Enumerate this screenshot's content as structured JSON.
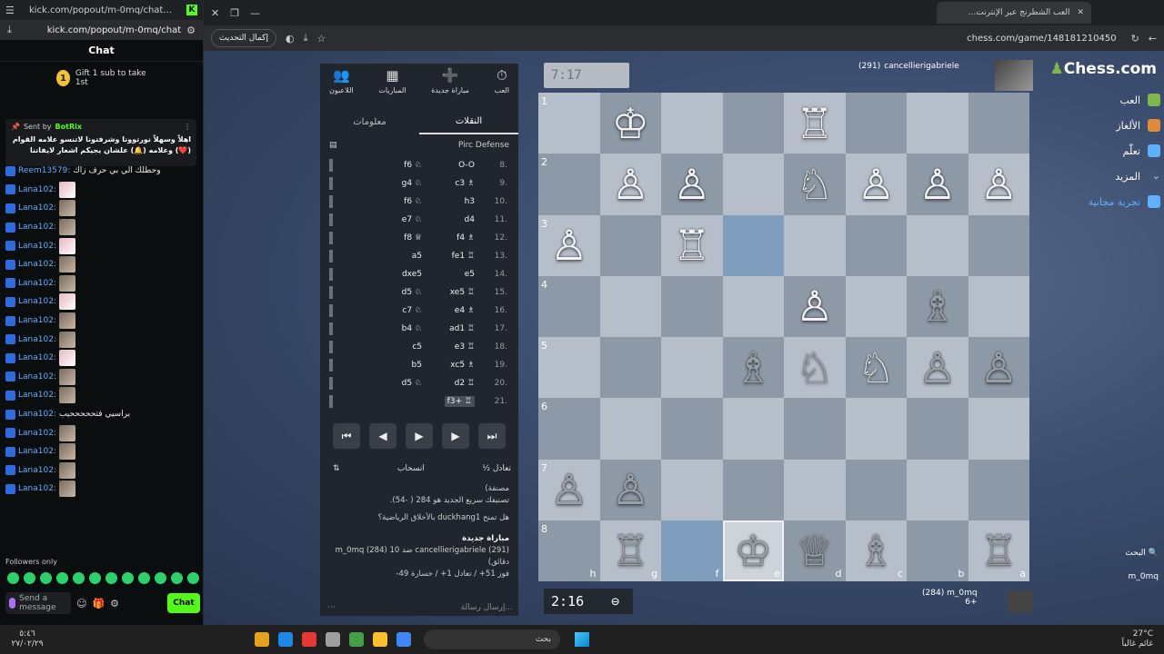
{
  "kick": {
    "title_url": "kick.com/popout/m-0mq/chat...",
    "url": "kick.com/popout/m-0mq/chat",
    "chat_title": "Chat",
    "gift_number": "1",
    "gift_text": "Gift 1 sub to take 1st",
    "pinned": {
      "sent_by": "Sent by",
      "bot_name": "BotRix",
      "message": "اهلاً وسهلاً نورتوونا وشرفتونا لاتنسو علامه القوام (❤️) وعلامه (🔔) علشان يجيكم اشعار لايفاتنا"
    },
    "messages": [
      {
        "user": "Reem13579:",
        "text": "وحطلك الي بي حرف زاك",
        "emote": ""
      },
      {
        "user": "Lana102:",
        "text": "",
        "emote": "pink"
      },
      {
        "user": "Lana102:",
        "text": "",
        "emote": "photo"
      },
      {
        "user": "Lana102:",
        "text": "",
        "emote": "photo"
      },
      {
        "user": "Lana102:",
        "text": "",
        "emote": "pink"
      },
      {
        "user": "Lana102:",
        "text": "",
        "emote": "photo"
      },
      {
        "user": "Lana102:",
        "text": "",
        "emote": "photo"
      },
      {
        "user": "Lana102:",
        "text": "",
        "emote": "pink"
      },
      {
        "user": "Lana102:",
        "text": "",
        "emote": "photo"
      },
      {
        "user": "Lana102:",
        "text": "",
        "emote": "photo"
      },
      {
        "user": "Lana102:",
        "text": "",
        "emote": "pink"
      },
      {
        "user": "Lana102:",
        "text": "",
        "emote": "photo"
      },
      {
        "user": "Lana102:",
        "text": "",
        "emote": "photo"
      },
      {
        "user": "Lana102:",
        "text": "براسيي فتحححححيب",
        "emote": ""
      },
      {
        "user": "Lana102:",
        "text": "",
        "emote": "photo"
      },
      {
        "user": "Lana102:",
        "text": "",
        "emote": "photo"
      },
      {
        "user": "Lana102:",
        "text": "",
        "emote": "photo"
      },
      {
        "user": "Lana102:",
        "text": "",
        "emote": "photo"
      }
    ],
    "followers_only": "Followers only",
    "send_placeholder": "Send a message",
    "chat_button": "Chat"
  },
  "browser": {
    "tab_title": "العب الشطرنج عبر الإنترنت...",
    "update_button": "إكمال التحديث",
    "url": "chess.com/game/148181210450"
  },
  "moves_panel": {
    "icons": [
      {
        "label": "العب",
        "sym": "⏱"
      },
      {
        "label": "مباراة جديدة",
        "sym": "➕"
      },
      {
        "label": "المباريات",
        "sym": "▦"
      },
      {
        "label": "اللاعبون",
        "sym": "👥"
      }
    ],
    "tab_moves": "النقلات",
    "tab_info": "معلومات",
    "opening": "Pirc Defense",
    "moves": [
      {
        "num": "8.",
        "white": "O-O",
        "black": "f6 ♘"
      },
      {
        "num": "9.",
        "white": "c3 ♗",
        "black": "g4 ♘"
      },
      {
        "num": "10.",
        "white": "h3",
        "black": "f6 ♘"
      },
      {
        "num": "11.",
        "white": "d4",
        "black": "e7 ♘"
      },
      {
        "num": "12.",
        "white": "f4 ♗",
        "black": "f8 ♕"
      },
      {
        "num": "13.",
        "white": "fe1 ♖",
        "black": "a5"
      },
      {
        "num": "14.",
        "white": "e5",
        "black": "dxe5"
      },
      {
        "num": "15.",
        "white": "xe5 ♖",
        "black": "d5 ♘"
      },
      {
        "num": "16.",
        "white": "e4 ♗",
        "black": "c7 ♘"
      },
      {
        "num": "17.",
        "white": "ad1 ♖",
        "black": "b4 ♘"
      },
      {
        "num": "18.",
        "white": "e3 ♖",
        "black": "c5"
      },
      {
        "num": "19.",
        "white": "xc5 ♗",
        "black": "b5"
      },
      {
        "num": "20.",
        "white": "d2 ♖",
        "black": "d5 ♘"
      },
      {
        "num": "21.",
        "white": "f3+ ♖",
        "black": ""
      }
    ],
    "draw": "½ تعادل",
    "resign": "انسحاب",
    "info_lines": [
      "مصنفة)",
      "تصنيفك سريع الجديد هو 284 ( -54)."
    ],
    "question": "هل تمنح duckhang1 بالأخلاق الرياضية؟",
    "new_game": "مباراة جديدة",
    "game_summary": "cancellierigabriele (291) ضد m_0mq (284) 10 دقائق)",
    "record": "فوز 51+ / تعادل 1+ / خسارة 49-",
    "message_placeholder": "إرسال رسالة..."
  },
  "game": {
    "top_clock": "7:17",
    "top_player": "cancellierigabriele",
    "top_rating": "(291)",
    "bottom_clock": "2:16",
    "bottom_player": "m_0mq",
    "bottom_rating": "(284)",
    "bottom_extra": "6+",
    "ranks": [
      "1",
      "2",
      "3",
      "4",
      "5",
      "6",
      "7",
      "8"
    ],
    "files": [
      "h",
      "g",
      "f",
      "e",
      "d",
      "c",
      "b",
      "a"
    ],
    "board_rows": [
      [
        "",
        "wK",
        "",
        "",
        "wR",
        "",
        "",
        ""
      ],
      [
        "",
        "wP",
        "wP",
        "",
        "wN",
        "wP",
        "wP",
        "wP"
      ],
      [
        "wP",
        "",
        "wR",
        "",
        "",
        "",
        "",
        ""
      ],
      [
        "",
        "",
        "",
        "",
        "wP",
        "",
        "bB",
        ""
      ],
      [
        "",
        "",
        "",
        "bB",
        "bN",
        "wN",
        "bP",
        "bP"
      ],
      [
        "",
        "",
        "",
        "",
        "",
        "",
        "",
        ""
      ],
      [
        "bP",
        "bP",
        "",
        "",
        "",
        "",
        "",
        ""
      ],
      [
        "",
        "bR",
        "",
        "bK",
        "bQ",
        "bB",
        "",
        "bR"
      ]
    ]
  },
  "site_nav": {
    "logo_prefix": "♟",
    "logo": "Chess.com",
    "items": [
      "العب",
      "الألغاز",
      "تعلّم",
      "المزيد"
    ],
    "free_trial": "تجربة مجانية",
    "search": "البحث",
    "user": "m_0mq"
  },
  "taskbar": {
    "time": "٥:٤٦",
    "date": "٢٧/٠٢/٢٩",
    "search": "بحث",
    "weather": "27°C",
    "weather_desc": "غائم غالباً"
  }
}
